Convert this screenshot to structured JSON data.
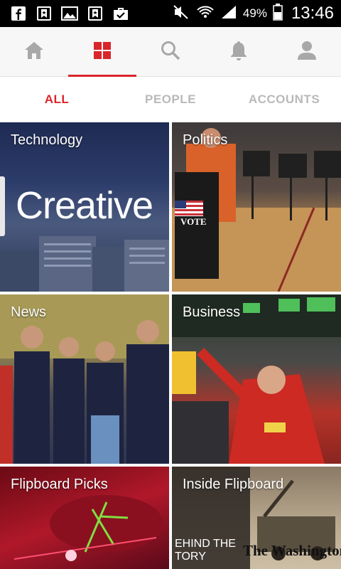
{
  "status_bar": {
    "battery_percent": "49%",
    "time": "13:46",
    "left_icons": [
      "facebook-icon",
      "saved-icon",
      "gallery-icon",
      "saved-icon",
      "briefcase-check-icon"
    ],
    "right_icons": [
      "mute-icon",
      "wifi-icon",
      "signal-icon",
      "battery-icon"
    ]
  },
  "top_nav": {
    "items": [
      {
        "name": "home",
        "icon": "home-icon",
        "active": false
      },
      {
        "name": "content",
        "icon": "grid-icon",
        "active": true
      },
      {
        "name": "search",
        "icon": "search-icon",
        "active": false
      },
      {
        "name": "notifications",
        "icon": "bell-icon",
        "active": false
      },
      {
        "name": "profile",
        "icon": "person-icon",
        "active": false
      }
    ],
    "accent_color": "#d9262b"
  },
  "sub_tabs": [
    {
      "label": "ALL",
      "active": true
    },
    {
      "label": "PEOPLE",
      "active": false
    },
    {
      "label": "ACCOUNTS",
      "active": false
    }
  ],
  "tiles": [
    {
      "label": "Technology",
      "overlay_text": "Creative"
    },
    {
      "label": "Politics",
      "overlay_text": "VOTE"
    },
    {
      "label": "News"
    },
    {
      "label": "Business"
    },
    {
      "label": "Flipboard Picks"
    },
    {
      "label": "Inside Flipboard",
      "overlay_text_left": "EHIND THE\nTORY",
      "overlay_text_right": "The Washington"
    }
  ]
}
